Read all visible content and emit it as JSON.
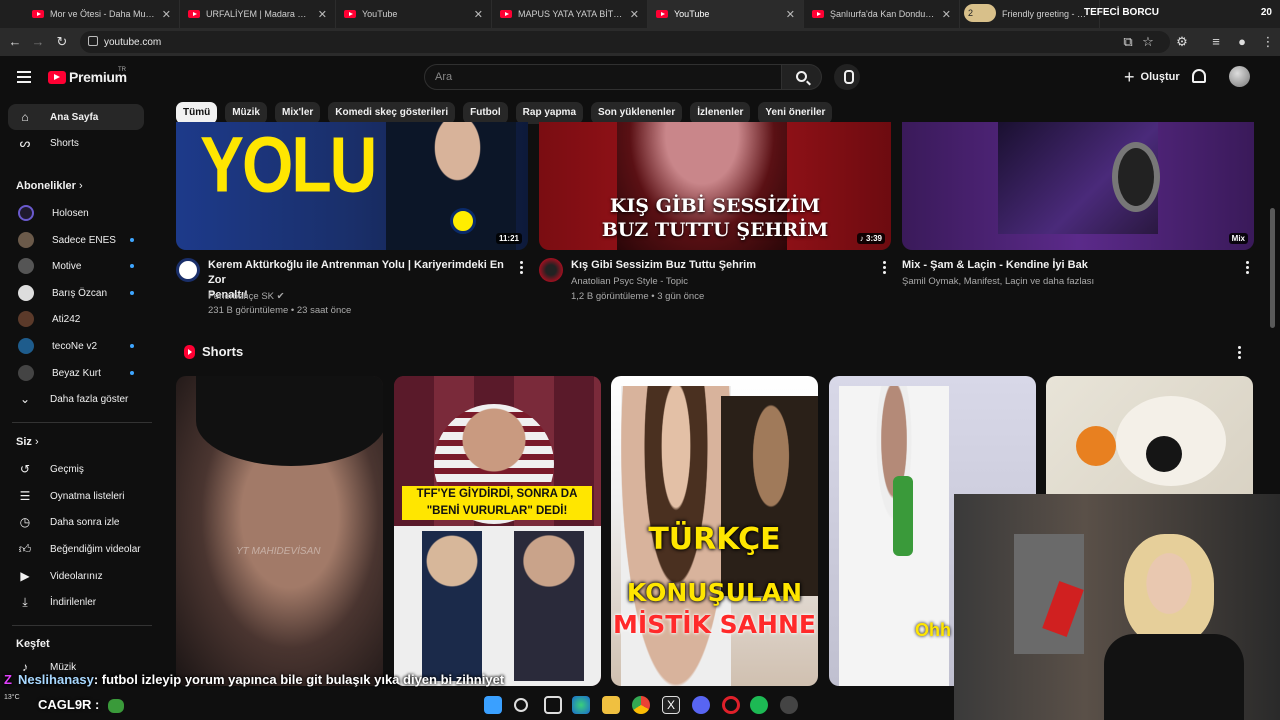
{
  "browser": {
    "tabs": [
      {
        "title": "Mor ve Ötesi - Daha Mutlu Olam"
      },
      {
        "title": "URFALİYEM | Madara Olduk #6"
      },
      {
        "title": "YouTube"
      },
      {
        "title": "MAPUS YATA YATA BİTER | Kan"
      },
      {
        "title": "YouTube"
      },
      {
        "title": "Şanlıurfa'da Kan Donduran Ol"
      },
      {
        "title": "Friendly greeting - Grok"
      }
    ],
    "grok_badge": "2",
    "stream_overlay_title": "TEFECİ BORCU",
    "stream_overlay_count": "20",
    "url": "youtube.com"
  },
  "header": {
    "logo_text": "Premium",
    "logo_region": "TR",
    "search_placeholder": "Ara",
    "create_label": "Oluştur"
  },
  "chips": [
    "Tümü",
    "Müzik",
    "Mix'ler",
    "Komedi skeç gösterileri",
    "Futbol",
    "Rap yapma",
    "Son yüklenenler",
    "İzlenenler",
    "Yeni öneriler"
  ],
  "sidebar": {
    "home": "Ana Sayfa",
    "shorts": "Shorts",
    "subscriptions_title": "Abonelikler",
    "channels": [
      "Holosen",
      "Sadece ENES",
      "Motive",
      "Barış Özcan",
      "Ati242",
      "tecoNe v2",
      "Beyaz Kurt"
    ],
    "show_more": "Daha fazla göster",
    "you_title": "Siz",
    "you_items": [
      "Geçmiş",
      "Oynatma listeleri",
      "Daha sonra izle",
      "Beğendiğim videolar",
      "Videolarınız",
      "İndirilenler"
    ],
    "explore_title": "Keşfet",
    "explore_items": [
      "Müzik"
    ]
  },
  "videos": [
    {
      "title_line1": "Kerem Aktürkoğlu ile Antrenman Yolu | Kariyerimdeki En Zor",
      "title_line2": "Penaltı!",
      "channel": "Fenerbahçe SK",
      "meta": "231 B görüntüleme • 23 saat önce",
      "duration": "11:21",
      "thumb_text": "YOLU"
    },
    {
      "title_line1": "Kış Gibi Sessizim Buz Tuttu Şehrim",
      "title_line2": "",
      "channel": "Anatolian Psyc Style - Topic",
      "meta": "1,2 B görüntüleme • 3 gün önce",
      "duration": "♪ 3:39",
      "thumb_line1": "KIŞ GİBİ SESSİZİM",
      "thumb_line2": "BUZ TUTTU ŞEHRİM"
    },
    {
      "title_line1": "Mix - Şam & Laçin - Kendine İyi Bak",
      "title_line2": "",
      "channel": "Şamil Oymak, Manifest, Laçin ve daha fazlası",
      "meta": "",
      "duration": "Mix"
    }
  ],
  "shorts": {
    "title": "Shorts",
    "items": [
      {
        "overlay": "YT MAHIDEVİSAN"
      },
      {
        "overlay_line1": "TFF'YE GİYDİRDİ, SONRA DA",
        "overlay_line2": "\"BENİ VURURLAR\" DEDİ!"
      },
      {
        "overlay_line1": "TÜRKÇE",
        "overlay_line2": "KONUŞULAN",
        "overlay_line3": "MİSTİK SAHNE"
      },
      {
        "overlay": "Ohh"
      },
      {
        "overlay": ""
      }
    ]
  },
  "stream": {
    "chat_user": "Neslihanasy",
    "chat_message": ": futbol izleyip yorum yapınca bile git bulaşık yıka diyen bi zihniyet",
    "streamer_tag": "CAGL9R :",
    "weather": "13°C"
  }
}
